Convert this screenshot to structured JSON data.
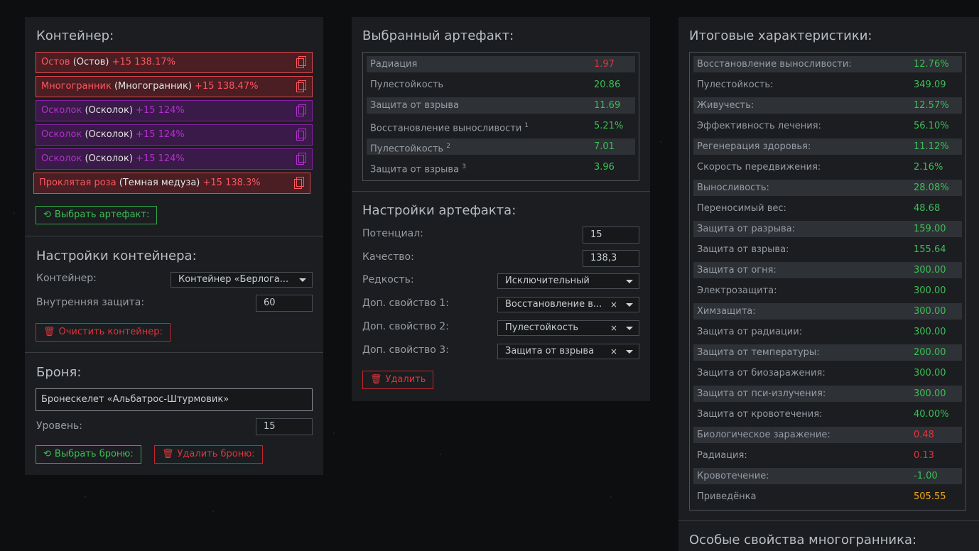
{
  "container_panel": {
    "title": "Контейнер:",
    "artifacts": [
      {
        "name": "Остов",
        "type": "(Остов)",
        "bonus": "+15 138.17%",
        "color": "red"
      },
      {
        "name": "Многогранник",
        "type": "(Многогранник)",
        "bonus": "+15 138.47%",
        "color": "red"
      },
      {
        "name": "Осколок",
        "type": "(Осколок)",
        "bonus": "+15 124%",
        "color": "purple"
      },
      {
        "name": "Осколок",
        "type": "(Осколок)",
        "bonus": "+15 124%",
        "color": "purple"
      },
      {
        "name": "Осколок",
        "type": "(Осколок)",
        "bonus": "+15 124%",
        "color": "purple"
      },
      {
        "name": "Проклятая роза",
        "type": "(Темная медуза)",
        "bonus": "+15 138.3%",
        "color": "red"
      }
    ],
    "select_artifact_button": "Выбрать артефакт:",
    "settings_title": "Настройки контейнера:",
    "container_label": "Контейнер:",
    "container_value": "Контейнер «Берлога...",
    "inner_protection_label": "Внутренняя защита:",
    "inner_protection_value": "60",
    "clear_button": "Очистить контейнер:",
    "armor_title": "Броня:",
    "armor_value": "Бронескелет «Альбатрос-Штурмовик»",
    "level_label": "Уровень:",
    "level_value": "15",
    "select_armor_button": "Выбрать броню:",
    "delete_armor_button": "Удалить броню:"
  },
  "selected_artifact": {
    "title": "Выбранный артефакт:",
    "stats": [
      {
        "label": "Радиация",
        "sup": "",
        "value": "1.97",
        "color": "red"
      },
      {
        "label": "Пулестойкость",
        "sup": "",
        "value": "20.86",
        "color": "green"
      },
      {
        "label": "Защита от взрыва",
        "sup": "",
        "value": "11.69",
        "color": "green"
      },
      {
        "label": "Восстановление выносливости",
        "sup": "1",
        "value": "5.21%",
        "color": "green"
      },
      {
        "label": "Пулестойкость",
        "sup": "2",
        "value": "7.01",
        "color": "green"
      },
      {
        "label": "Защита от взрыва",
        "sup": "3",
        "value": "3.96",
        "color": "green"
      }
    ],
    "settings_title": "Настройки артефакта:",
    "potential_label": "Потенциал:",
    "potential_value": "15",
    "quality_label": "Качество:",
    "quality_value": "138,3",
    "rarity_label": "Редкость:",
    "rarity_value": "Исключительный",
    "extra1_label": "Доп. свойство 1:",
    "extra1_value": "Восстановление в...",
    "extra2_label": "Доп. свойство 2:",
    "extra2_value": "Пулестойкость",
    "extra3_label": "Доп. свойство 3:",
    "extra3_value": "Защита от взрыва",
    "clear_symbol": "×",
    "delete_button": "Удалить"
  },
  "totals": {
    "title": "Итоговые характеристики:",
    "stats": [
      {
        "label": "Восстановление выносливости:",
        "value": "12.76%",
        "color": "green"
      },
      {
        "label": "Пулестойкость:",
        "value": "349.09",
        "color": "green"
      },
      {
        "label": "Живучесть:",
        "value": "12.57%",
        "color": "green"
      },
      {
        "label": "Эффективность лечения:",
        "value": "56.10%",
        "color": "green"
      },
      {
        "label": "Регенерация здоровья:",
        "value": "11.12%",
        "color": "green"
      },
      {
        "label": "Скорость передвижения:",
        "value": "2.16%",
        "color": "green"
      },
      {
        "label": "Выносливость:",
        "value": "28.08%",
        "color": "green"
      },
      {
        "label": "Переносимый вес:",
        "value": "48.68",
        "color": "green"
      },
      {
        "label": "Защита от разрыва:",
        "value": "159.00",
        "color": "green"
      },
      {
        "label": "Защита от взрыва:",
        "value": "155.64",
        "color": "green"
      },
      {
        "label": "Защита от огня:",
        "value": "300.00",
        "color": "green"
      },
      {
        "label": "Электрозащита:",
        "value": "300.00",
        "color": "green"
      },
      {
        "label": "Химзащита:",
        "value": "300.00",
        "color": "green"
      },
      {
        "label": "Защита от радиации:",
        "value": "300.00",
        "color": "green"
      },
      {
        "label": "Защита от температуры:",
        "value": "200.00",
        "color": "green"
      },
      {
        "label": "Защита от биозаражения:",
        "value": "300.00",
        "color": "green"
      },
      {
        "label": "Защита от пси-излучения:",
        "value": "300.00",
        "color": "green"
      },
      {
        "label": "Защита от кровотечения:",
        "value": "40.00%",
        "color": "green"
      },
      {
        "label": "Биологическое заражение:",
        "value": "0.48",
        "color": "red"
      },
      {
        "label": "Радиация:",
        "value": "0.13",
        "color": "red"
      },
      {
        "label": "Кровотечение:",
        "value": "-1.00",
        "color": "green"
      },
      {
        "label": "Приведёнка",
        "value": "505.55",
        "color": "yellow"
      }
    ],
    "special_title": "Особые свойства многогранника:"
  }
}
